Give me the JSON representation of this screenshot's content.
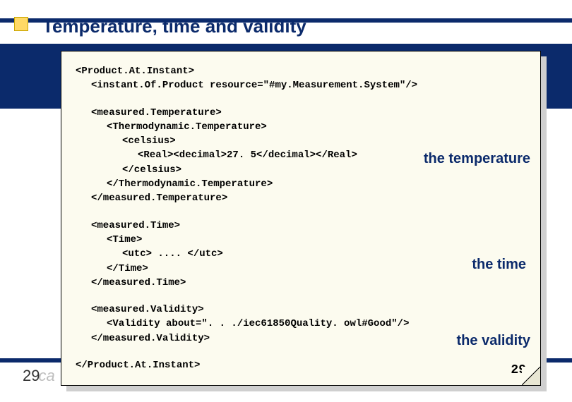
{
  "slide": {
    "title": "Temperature, time and validity",
    "page_left": "29",
    "page_left_ghost": "ca",
    "page_right": "29"
  },
  "code": {
    "l1": "<Product.At.Instant>",
    "l2": "<instant.Of.Product resource=\"#my.Measurement.System\"/>",
    "l3": "<measured.Temperature>",
    "l4": "<Thermodynamic.Temperature>",
    "l5": "<celsius>",
    "l6": "<Real><decimal>27. 5</decimal></Real>",
    "l7": "</celsius>",
    "l8": "</Thermodynamic.Temperature>",
    "l9": "</measured.Temperature>",
    "l10": "<measured.Time>",
    "l11": "<Time>",
    "l12": "<utc>  ....  </utc>",
    "l13": "</Time>",
    "l14": "</measured.Time>",
    "l15": "<measured.Validity>",
    "l16": "<Validity about=\". . ./iec61850Quality. owl#Good\"/>",
    "l17": "</measured.Validity>",
    "l18": "</Product.At.Instant>"
  },
  "annotations": {
    "temperature": "the temperature",
    "time": "the time",
    "validity": "the validity"
  }
}
